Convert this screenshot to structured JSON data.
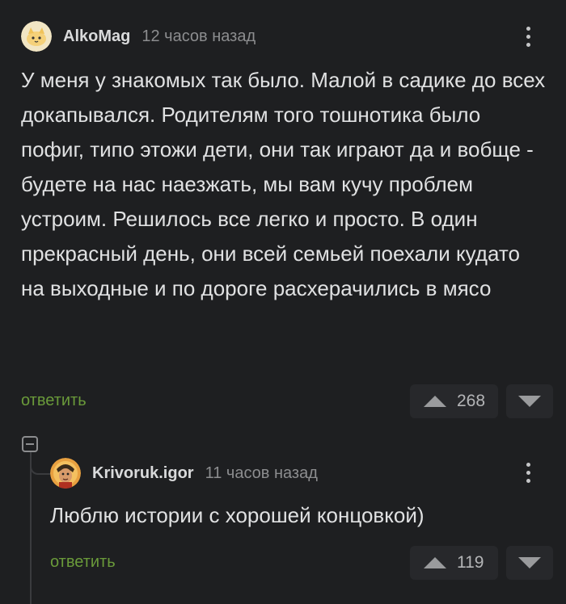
{
  "comments": [
    {
      "author": "AlkoMag",
      "time": "12 часов назад",
      "text": "У меня у знакомых так было. Малой в садике до всех докапывался. Родителям того тошнотика было пофиг, типо этожи дети, они так играют да и вобще - будете на нас наезжать, мы вам кучу проблем устроим. Решилось все легко и просто. В один прекрасный день, они всей семьей поехали кудато на выходные и по дороге расхерачились в мясо",
      "reply_label": "ответить",
      "votes": "268",
      "avatar_icon": "cat-avatar-icon"
    },
    {
      "author": "Krivoruk.igor",
      "time": "11 часов назад",
      "text": "Люблю истории с хорошей концовкой)",
      "reply_label": "ответить",
      "votes": "119",
      "avatar_icon": "character-avatar-icon"
    }
  ],
  "colors": {
    "background": "#1e1f21",
    "reply_link": "#6a9a3a",
    "vote_box": "#27282b"
  }
}
